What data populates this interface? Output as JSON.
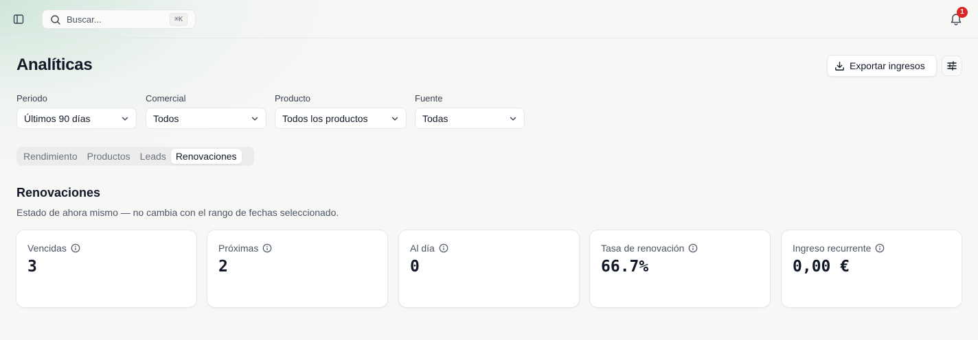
{
  "topbar": {
    "search_placeholder": "Buscar...",
    "search_shortcut": "⌘K",
    "notification_count": "1"
  },
  "page": {
    "title": "Analíticas",
    "export_label": "Exportar ingresos"
  },
  "filters": [
    {
      "label": "Periodo",
      "value": "Últimos 90 días"
    },
    {
      "label": "Comercial",
      "value": "Todos"
    },
    {
      "label": "Producto",
      "value": "Todos los productos"
    },
    {
      "label": "Fuente",
      "value": "Todas"
    }
  ],
  "tabs": [
    {
      "label": "Rendimiento",
      "active": false
    },
    {
      "label": "Productos",
      "active": false
    },
    {
      "label": "Leads",
      "active": false
    },
    {
      "label": "Renovaciones",
      "active": true
    }
  ],
  "section": {
    "title": "Renovaciones",
    "subtitle": "Estado de ahora mismo — no cambia con el rango de fechas seleccionado."
  },
  "cards": [
    {
      "label": "Vencidas",
      "value": "3"
    },
    {
      "label": "Próximas",
      "value": "2"
    },
    {
      "label": "Al día",
      "value": "0"
    },
    {
      "label": "Tasa de renovación",
      "value": "66.7%"
    },
    {
      "label": "Ingreso recurrente",
      "value": "0,00 €"
    }
  ],
  "colors": {
    "badge": "#dc2626",
    "text": "#111827",
    "muted": "#4b5563",
    "border": "#e5e7eb"
  },
  "icons": {
    "sidebar_toggle": "sidebar-toggle-icon",
    "search": "search-icon",
    "bell": "bell-icon",
    "download": "download-icon",
    "settings": "sliders-icon",
    "chevron": "chevron-down-icon",
    "info": "info-icon"
  }
}
